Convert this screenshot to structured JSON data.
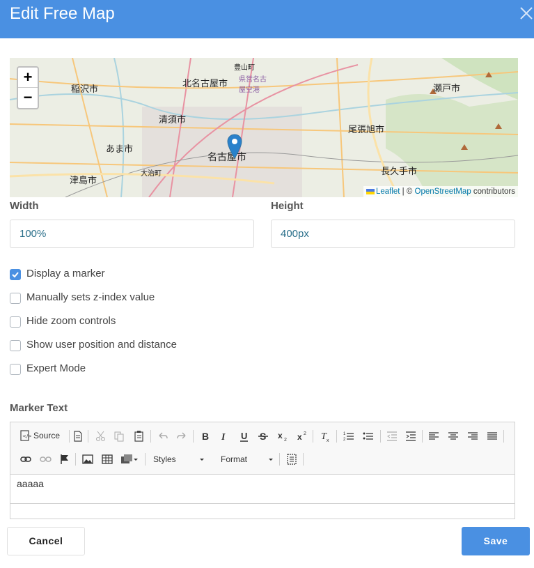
{
  "dialog": {
    "title": "Edit Free Map",
    "close_icon": "close-icon"
  },
  "map": {
    "zoom_in": "+",
    "zoom_out": "−",
    "attribution": {
      "leaflet": "Leaflet",
      "separator": " | © ",
      "osm": "OpenStreetMap",
      "suffix": " contributors"
    },
    "labels": [
      "稲沢市",
      "北名古屋市",
      "豊山町",
      "県営名古屋空港",
      "瀬戸市",
      "清須市",
      "あま市",
      "尾張旭市",
      "名古屋市",
      "大治町",
      "津島市",
      "長久手市"
    ]
  },
  "form": {
    "width_label": "Width",
    "width_value": "100%",
    "height_label": "Height",
    "height_value": "400px",
    "checkboxes": [
      {
        "label": "Display a marker",
        "checked": true
      },
      {
        "label": "Manually sets z-index value",
        "checked": false
      },
      {
        "label": "Hide zoom controls",
        "checked": false
      },
      {
        "label": "Show user position and distance",
        "checked": false
      },
      {
        "label": "Expert Mode",
        "checked": false
      }
    ],
    "marker_text_label": "Marker Text"
  },
  "editor": {
    "source_label": "Source",
    "styles_label": "Styles",
    "format_label": "Format",
    "content": "aaaaa"
  },
  "footer": {
    "cancel_label": "Cancel",
    "save_label": "Save"
  },
  "colors": {
    "accent": "#4a90e2"
  }
}
